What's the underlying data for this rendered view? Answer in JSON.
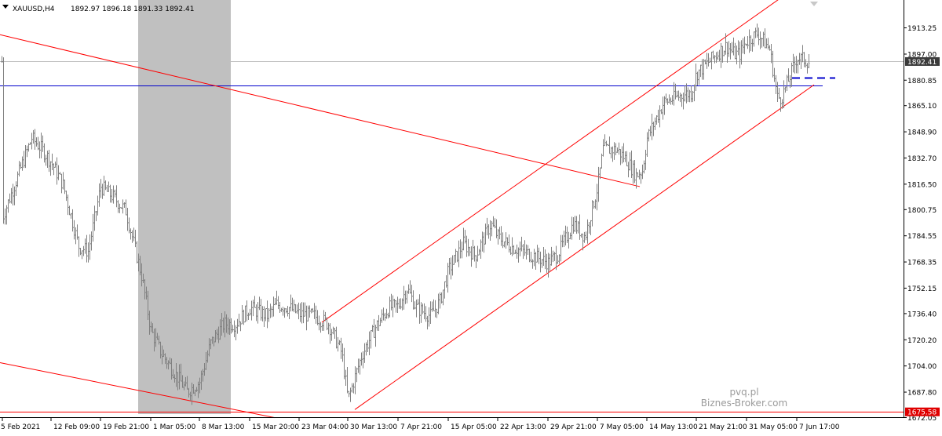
{
  "header": {
    "menu_arrow": "triangle-down-icon",
    "symbol": "XAUUSD,H4",
    "ohlc": "1892.97 1896.18 1891.33 1892.41"
  },
  "watermark": {
    "line1": "pvq.pl",
    "line2": "Biznes-Broker.com"
  },
  "price_tags": {
    "current": {
      "value": 1892.41,
      "label": "1892.41",
      "bg": "#3a3a3a",
      "fg": "#ffffff"
    },
    "support": {
      "value": 1675.58,
      "label": "1675.58",
      "bg": "#e00000",
      "fg": "#ffffff"
    }
  },
  "chart_data": {
    "type": "candlestick",
    "symbol": "XAUUSD",
    "timeframe": "H4",
    "ylim": [
      1672.0,
      1929.0
    ],
    "y_ticks": [
      1913.25,
      1897.0,
      1880.85,
      1865.1,
      1848.9,
      1832.7,
      1816.5,
      1800.75,
      1784.55,
      1768.35,
      1752.15,
      1736.4,
      1720.2,
      1704.0,
      1687.8,
      1672.05
    ],
    "y_tick_labels": [
      "1913.25",
      "1897.00",
      "1880.85",
      "1865.10",
      "1848.90",
      "1832.70",
      "1816.50",
      "1800.75",
      "1784.55",
      "1768.35",
      "1752.15",
      "1736.40",
      "1720.20",
      "1704.00",
      "1687.80",
      "1672.05"
    ],
    "x_tick_labels": [
      "5 Feb 2021",
      "12 Feb 09:00",
      "19 Feb 21:00",
      "1 Mar 05:00",
      "8 Mar 13:00",
      "15 Mar 20:00",
      "23 Mar 04:00",
      "30 Mar 13:00",
      "7 Apr 21:00",
      "15 Apr 05:00",
      "22 Apr 13:00",
      "29 Apr 21:00",
      "7 May 05:00",
      "14 May 13:00",
      "21 May 21:00",
      "31 May 05:00",
      "7 Jun 17:00"
    ],
    "x_range": [
      "5 Feb 2021",
      "7 Jun 17:00"
    ],
    "price_path": [
      [
        "5 Feb 2021",
        1796
      ],
      [
        "9 Feb",
        1845
      ],
      [
        "11 Feb",
        1837
      ],
      [
        "12 Feb 09:00",
        1830
      ],
      [
        "15 Feb",
        1816
      ],
      [
        "17 Feb",
        1778
      ],
      [
        "18 Feb",
        1775
      ],
      [
        "19 Feb 21:00",
        1815
      ],
      [
        "22 Feb",
        1808
      ],
      [
        "24 Feb",
        1800
      ],
      [
        "26 Feb",
        1760
      ],
      [
        "1 Mar 05:00",
        1726
      ],
      [
        "3 Mar",
        1712
      ],
      [
        "4 Mar",
        1700
      ],
      [
        "5 Mar",
        1688
      ],
      [
        "8 Mar 13:00",
        1694
      ],
      [
        "9 Mar",
        1718
      ],
      [
        "11 Mar",
        1730
      ],
      [
        "12 Mar",
        1730
      ],
      [
        "15 Mar 20:00",
        1740
      ],
      [
        "17 Mar",
        1735
      ],
      [
        "18 Mar",
        1742
      ],
      [
        "19 Mar",
        1740
      ],
      [
        "23 Mar 04:00",
        1736
      ],
      [
        "25 Mar",
        1735
      ],
      [
        "26 Mar",
        1730
      ],
      [
        "29 Mar",
        1712
      ],
      [
        "30 Mar 13:00",
        1683
      ],
      [
        "31 Mar",
        1710
      ],
      [
        "1 Apr",
        1728
      ],
      [
        "6 Apr",
        1740
      ],
      [
        "7 Apr 21:00",
        1741
      ],
      [
        "8 Apr",
        1752
      ],
      [
        "9 Apr",
        1740
      ],
      [
        "12 Apr",
        1735
      ],
      [
        "14 Apr",
        1744
      ],
      [
        "15 Apr 05:00",
        1763
      ],
      [
        "16 Apr",
        1780
      ],
      [
        "19 Apr",
        1772
      ],
      [
        "21 Apr",
        1792
      ],
      [
        "22 Apr 13:00",
        1784
      ],
      [
        "26 Apr",
        1778
      ],
      [
        "28 Apr",
        1772
      ],
      [
        "29 Apr 21:00",
        1768
      ],
      [
        "30 Apr",
        1773
      ],
      [
        "3 May",
        1792
      ],
      [
        "5 May",
        1784
      ],
      [
        "7 May 05:00",
        1815
      ],
      [
        "7 May 17:00",
        1838
      ],
      [
        "10 May",
        1838
      ],
      [
        "11 May",
        1832
      ],
      [
        "12 May",
        1822
      ],
      [
        "13 May",
        1825
      ],
      [
        "14 May 13:00",
        1845
      ],
      [
        "17 May",
        1867
      ],
      [
        "18 May",
        1870
      ],
      [
        "19 May",
        1872
      ],
      [
        "20 May",
        1873
      ],
      [
        "21 May 21:00",
        1885
      ],
      [
        "24 May",
        1898
      ],
      [
        "25 May",
        1902
      ],
      [
        "26 May",
        1897
      ],
      [
        "27 May",
        1897
      ],
      [
        "28 May",
        1905
      ],
      [
        "31 May 05:00",
        1905
      ],
      [
        "1 Jun",
        1910
      ],
      [
        "2 Jun",
        1900
      ],
      [
        "3 Jun",
        1870
      ],
      [
        "4 Jun",
        1870
      ],
      [
        "7 Jun",
        1882
      ],
      [
        "7 Jun 17:00",
        1895
      ],
      [
        "8 Jun",
        1892.41
      ]
    ],
    "shaded_region": {
      "from": "1 Mar 05:00",
      "to": "8 Mar 13:00",
      "color": "#c0c0c0"
    },
    "horizontal_lines": [
      {
        "value": 1892.41,
        "color": "#c0c0c0",
        "style": "solid"
      },
      {
        "value": 1877.7,
        "color": "#0000cc",
        "style": "solid",
        "extent": "to 7 Jun 17:00"
      },
      {
        "value": 1882.2,
        "color": "#0000cc",
        "style": "dashed",
        "extent": "8 Jun onward"
      },
      {
        "value": 1675.58,
        "color": "#ff0000",
        "style": "solid"
      }
    ],
    "trend_lines": [
      {
        "name": "",
        "color": "#ff0000",
        "from": [
          "5 Feb 2021",
          1909
        ],
        "to": [
          "14 May 13:00",
          1815
        ]
      },
      {
        "name": "",
        "color": "#ff0000",
        "from": [
          "5 Feb 2021",
          1706
        ],
        "to": [
          "15 Mar 20:00",
          1672
        ]
      },
      {
        "name": "",
        "color": "#ff0000",
        "from": [
          "23 Mar 04:00",
          1731
        ],
        "to": [
          "10 Jun",
          1935
        ]
      },
      {
        "name": "",
        "color": "#ff0000",
        "from": [
          "30 Mar 13:00",
          1677
        ],
        "to": [
          "8 Jun",
          1878
        ]
      }
    ],
    "grid": false,
    "legend": "none",
    "up_color": "#808080",
    "down_color": "#808080"
  }
}
